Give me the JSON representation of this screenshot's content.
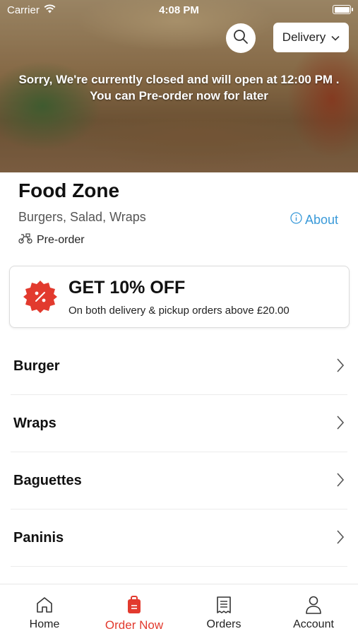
{
  "status": {
    "carrier": "Carrier",
    "time": "4:08 PM"
  },
  "header": {
    "delivery_label": "Delivery",
    "closed_line1": "Sorry, We're currently closed and will open at 12:00 PM .",
    "closed_line2": "You can Pre-order now for later"
  },
  "restaurant": {
    "name": "Food Zone",
    "cuisines": "Burgers, Salad, Wraps",
    "about_label": "About",
    "preorder_label": "Pre-order"
  },
  "offer": {
    "title": "GET 10% OFF",
    "subtitle": "On both delivery & pickup orders above £20.00"
  },
  "categories": [
    {
      "label": "Burger"
    },
    {
      "label": "Wraps"
    },
    {
      "label": "Baguettes"
    },
    {
      "label": "Paninis"
    }
  ],
  "nav": [
    {
      "label": "Home"
    },
    {
      "label": "Order Now"
    },
    {
      "label": "Orders"
    },
    {
      "label": "Account"
    }
  ],
  "colors": {
    "accent": "#e23a2e",
    "link": "#3a9ad9"
  }
}
